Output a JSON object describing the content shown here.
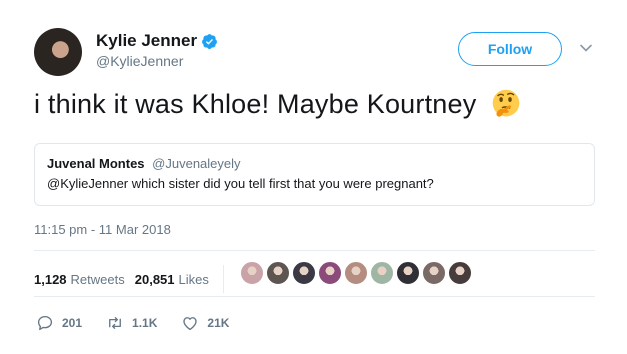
{
  "author": {
    "display_name": "Kylie Jenner",
    "handle": "@KylieJenner",
    "verified": true
  },
  "follow_button": {
    "label": "Follow"
  },
  "tweet": {
    "text": "i think it was Khloe! Maybe Kourtney",
    "emoji": "thinking-face-icon"
  },
  "quoted_tweet": {
    "display_name": "Juvenal Montes",
    "handle": "@Juvenaleyely",
    "text": "@KylieJenner which sister did you tell first that you were pregnant?"
  },
  "timestamp": "11:15 pm - 11 Mar 2018",
  "stats": {
    "retweets_count": "1,128",
    "retweets_label": "Retweets",
    "likes_count": "20,851",
    "likes_label": "Likes"
  },
  "likers_faces": [
    {
      "color": "#c9a3a8"
    },
    {
      "color": "#5d5552"
    },
    {
      "color": "#3b3a44"
    },
    {
      "color": "#8a4a7a"
    },
    {
      "color": "#b58d80"
    },
    {
      "color": "#9fb6a5"
    },
    {
      "color": "#2f2f35"
    },
    {
      "color": "#7a6a65"
    },
    {
      "color": "#463c3c"
    }
  ],
  "actions": {
    "replies": "201",
    "retweets": "1.1K",
    "likes": "21K"
  },
  "colors": {
    "accent": "#1da1f2",
    "secondary_text": "#657786",
    "border": "#e1e8ed"
  }
}
